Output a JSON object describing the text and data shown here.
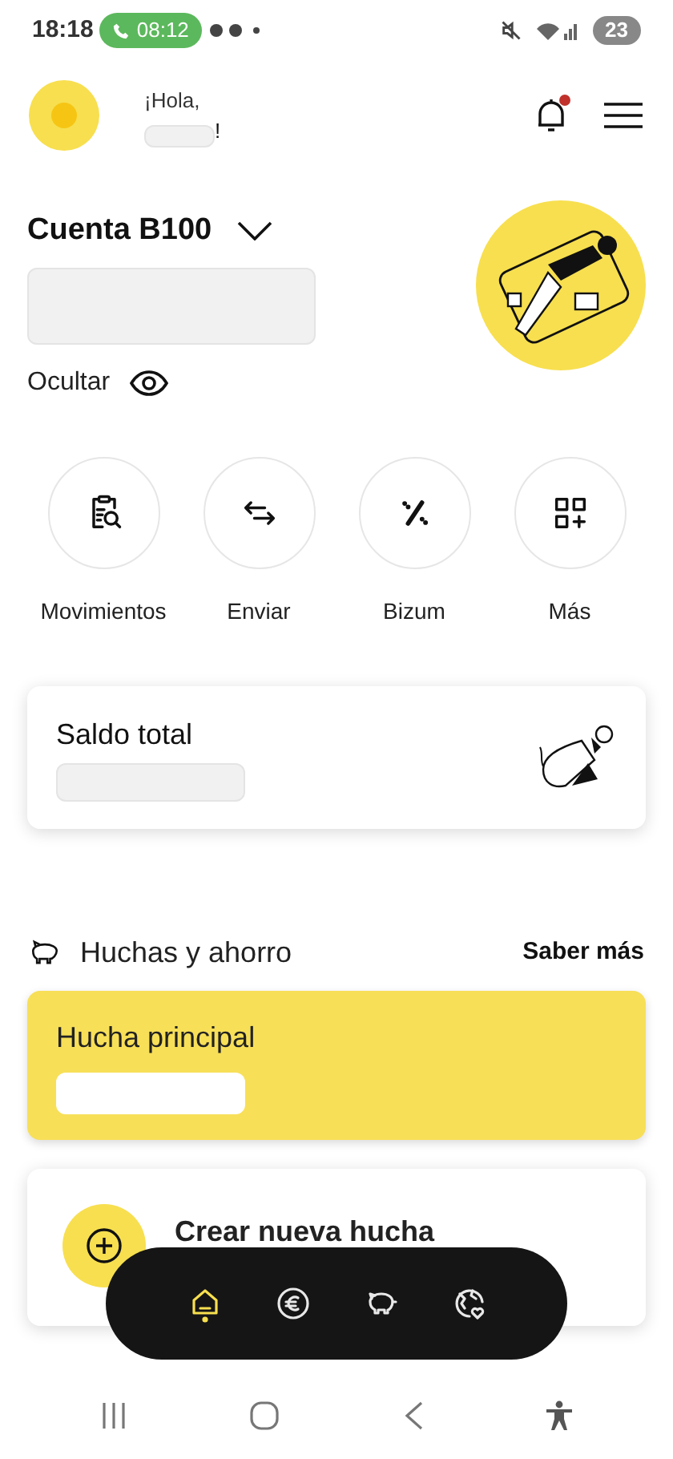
{
  "status_bar": {
    "time": "18:18",
    "call_time": "08:12",
    "battery": "23"
  },
  "header": {
    "greeting": "¡Hola,",
    "name_suffix": "!",
    "notification_dot": true
  },
  "account": {
    "title": "Cuenta B100",
    "hide_label": "Ocultar"
  },
  "actions": [
    {
      "label": "Movimientos",
      "kind": "movements"
    },
    {
      "label": "Enviar",
      "kind": "transfer"
    },
    {
      "label": "Bizum",
      "kind": "bizum"
    },
    {
      "label": "Más",
      "kind": "more"
    }
  ],
  "balance_card": {
    "title": "Saldo total"
  },
  "savings": {
    "title": "Huchas y ahorro",
    "link": "Saber más",
    "main_title": "Hucha principal",
    "create_label": "Crear nueva hucha"
  },
  "bottom_nav": [
    {
      "kind": "home",
      "selected": true
    },
    {
      "kind": "euro",
      "selected": false
    },
    {
      "kind": "piggy",
      "selected": false
    },
    {
      "kind": "world",
      "selected": false
    }
  ]
}
